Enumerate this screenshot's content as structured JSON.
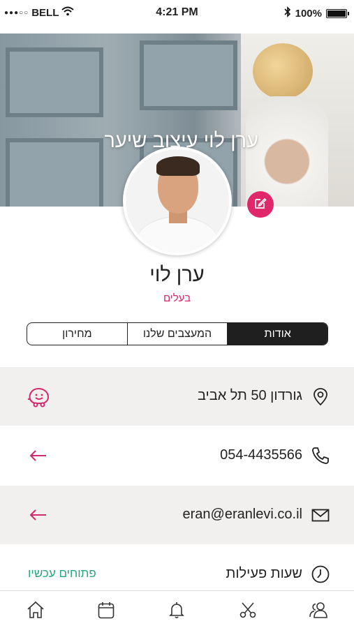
{
  "status_bar": {
    "carrier": "BELL",
    "signal_dots": "●●●○○",
    "time": "4:21 PM",
    "battery": "100%"
  },
  "hero": {
    "title": "ערן לוי עיצוב שיער"
  },
  "profile": {
    "name": "ערן לוי",
    "category": "בעלים"
  },
  "tabs": [
    {
      "label": "אודות",
      "active": true
    },
    {
      "label": "המעצבים שלנו",
      "active": false
    },
    {
      "label": "מחירון",
      "active": false
    }
  ],
  "info": {
    "address": "גורדון 50 תל אביב",
    "phone": "054-4435566",
    "email": "eran@eranlevi.co.il",
    "hours_label": "שעות פעילות",
    "hours_status": "פתוחים עכשיו"
  },
  "colors": {
    "accent": "#e0276a",
    "open_status": "#2aa57f",
    "active_tab": "#1f1f1f",
    "row_grey": "#f1f0ee"
  },
  "tabbar": [
    "home-icon",
    "calendar-icon",
    "bell-icon",
    "scissors-icon",
    "users-icon"
  ]
}
